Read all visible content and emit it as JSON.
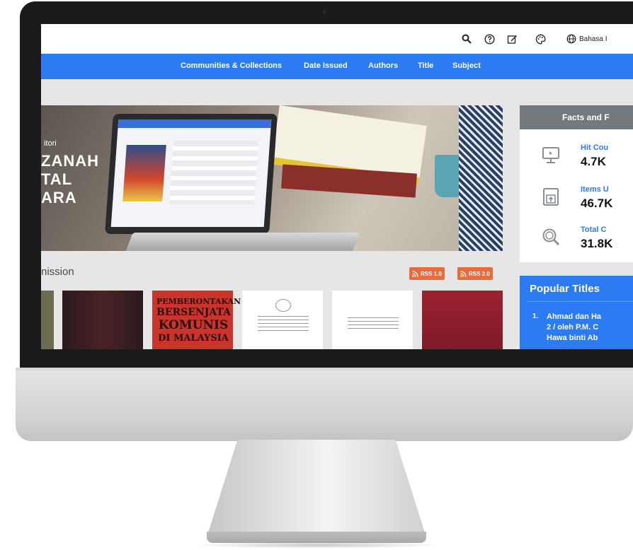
{
  "topbar": {
    "icons": [
      "search-icon",
      "help-icon",
      "edit-icon",
      "palette-icon",
      "globe-icon"
    ],
    "language_label": "Bahasa I"
  },
  "nav": {
    "items": [
      "Communities & Collections",
      "Date Issued",
      "Authors",
      "Title",
      "Subject"
    ],
    "active_color": "#2b7bf3"
  },
  "hero": {
    "small_text": "itori",
    "lines": [
      "ZANAH",
      "TAL",
      "ARA"
    ]
  },
  "facts": {
    "title": "Facts and F",
    "items": [
      {
        "label": "Hit Cou",
        "value": "4.7K",
        "icon": "monitor-icon"
      },
      {
        "label": "Items U",
        "value": "46.7K",
        "icon": "upload-box-icon"
      },
      {
        "label": "Total C",
        "value": "31.8K",
        "icon": "magnify-icon"
      }
    ]
  },
  "popular": {
    "title": "Popular Titles",
    "items": [
      {
        "num": "1.",
        "lines": [
          "Ahmad dan Ha",
          "2 / oleh P.M. C",
          "Hawa binti Ab"
        ]
      }
    ]
  },
  "submissions": {
    "title": "nission",
    "rss": [
      "RSS 1.0",
      "RSS 2.0"
    ],
    "cover_text": [
      "PEMBERONTAKAN",
      "BERSENJATA",
      "KOMUNIS",
      "DI MALAYSIA"
    ]
  },
  "colors": {
    "nav_blue": "#2b7bf3",
    "rss_orange": "#e86b3c",
    "facts_header": "#74797d"
  }
}
